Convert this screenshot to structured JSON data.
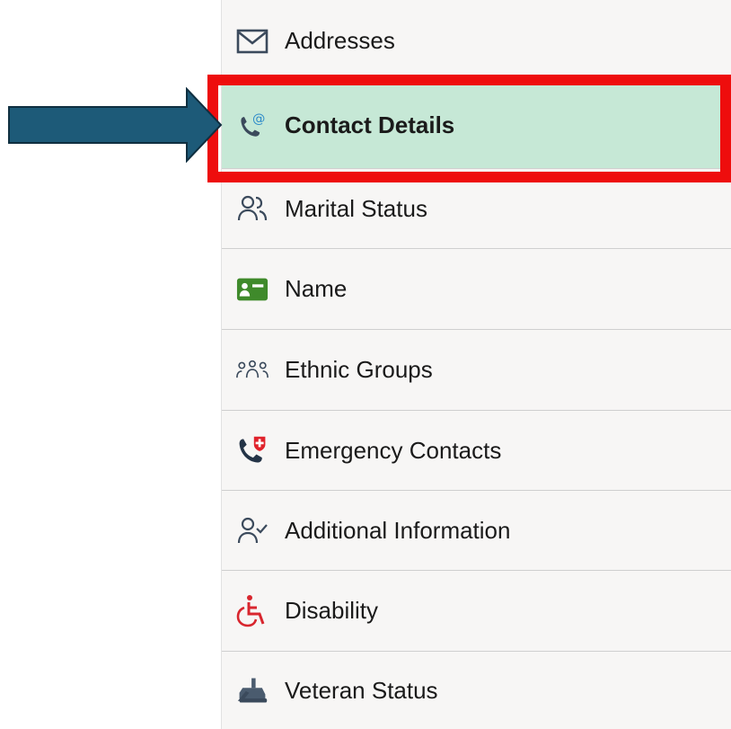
{
  "menu": {
    "items": [
      {
        "label": "Addresses",
        "icon": "envelope-icon",
        "selected": false
      },
      {
        "label": "Contact Details",
        "icon": "phone-at-icon",
        "selected": true
      },
      {
        "label": "Marital Status",
        "icon": "people-icon",
        "selected": false
      },
      {
        "label": "Name",
        "icon": "id-card-icon",
        "selected": false
      },
      {
        "label": "Ethnic Groups",
        "icon": "group-icon",
        "selected": false
      },
      {
        "label": "Emergency Contacts",
        "icon": "emergency-phone-icon",
        "selected": false
      },
      {
        "label": "Additional Information",
        "icon": "person-check-icon",
        "selected": false
      },
      {
        "label": "Disability",
        "icon": "wheelchair-icon",
        "selected": false
      },
      {
        "label": "Veteran Status",
        "icon": "veteran-icon",
        "selected": false
      }
    ]
  },
  "colors": {
    "selected_background": "#c6e8d6",
    "highlight_border": "#ee0d0d",
    "arrow_fill": "#1d5a78",
    "icon_dark": "#3b4a5c",
    "name_icon_green": "#3f8a2b",
    "emergency_red": "#e0222b",
    "disability_red": "#d8262e",
    "contact_blue": "#2e8bc9"
  }
}
